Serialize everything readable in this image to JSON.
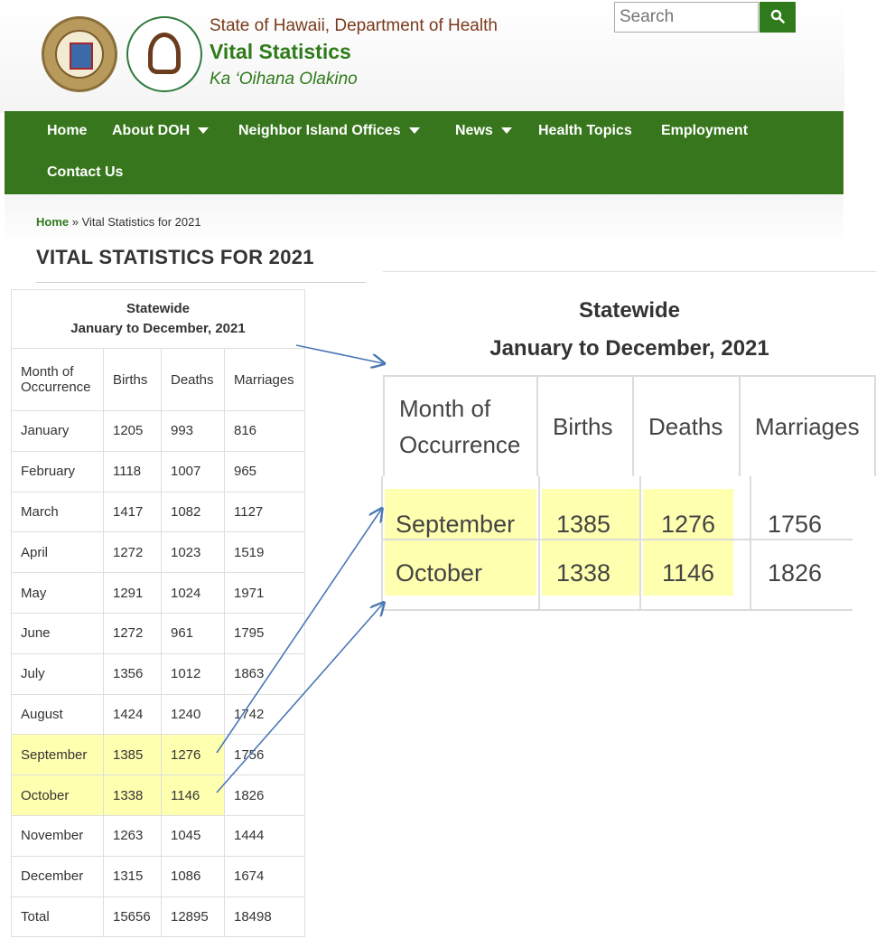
{
  "header": {
    "agency": "State of Hawaii, Department of Health",
    "site_title": "Vital Statistics",
    "subtitle": "Ka ‘Oihana Olakino",
    "search_placeholder": "Search"
  },
  "nav": {
    "items": [
      {
        "label": "Home",
        "dropdown": false
      },
      {
        "label": "About DOH",
        "dropdown": true
      },
      {
        "label": "Neighbor Island Offices",
        "dropdown": true
      },
      {
        "label": "News",
        "dropdown": true
      },
      {
        "label": "Health Topics",
        "dropdown": false
      },
      {
        "label": "Employment",
        "dropdown": false
      },
      {
        "label": "Contact Us",
        "dropdown": false
      }
    ]
  },
  "breadcrumb": {
    "home": "Home",
    "separator": " » ",
    "current": "Vital Statistics for 2021"
  },
  "page_title": "VITAL STATISTICS FOR 2021",
  "table": {
    "caption_line1": "Statewide",
    "caption_line2": "January to December, 2021",
    "headers": [
      "Month of Occurrence",
      "Births",
      "Deaths",
      "Marriages"
    ],
    "rows": [
      [
        "January",
        "1205",
        "993",
        "816"
      ],
      [
        "February",
        "1118",
        "1007",
        "965"
      ],
      [
        "March",
        "1417",
        "1082",
        "1127"
      ],
      [
        "April",
        "1272",
        "1023",
        "1519"
      ],
      [
        "May",
        "1291",
        "1024",
        "1971"
      ],
      [
        "June",
        "1272",
        "961",
        "1795"
      ],
      [
        "July",
        "1356",
        "1012",
        "1863"
      ],
      [
        "August",
        "1424",
        "1240",
        "1742"
      ],
      [
        "September",
        "1385",
        "1276",
        "1756"
      ],
      [
        "October",
        "1338",
        "1146",
        "1826"
      ],
      [
        "November",
        "1263",
        "1045",
        "1444"
      ],
      [
        "December",
        "1315",
        "1086",
        "1674"
      ],
      [
        "Total",
        "15656",
        "12895",
        "18498"
      ]
    ],
    "highlighted_rows": [
      8,
      9
    ]
  },
  "colors": {
    "brand_green": "#37761d",
    "highlight": "#ffffb0",
    "arrow": "#4a78b5"
  }
}
